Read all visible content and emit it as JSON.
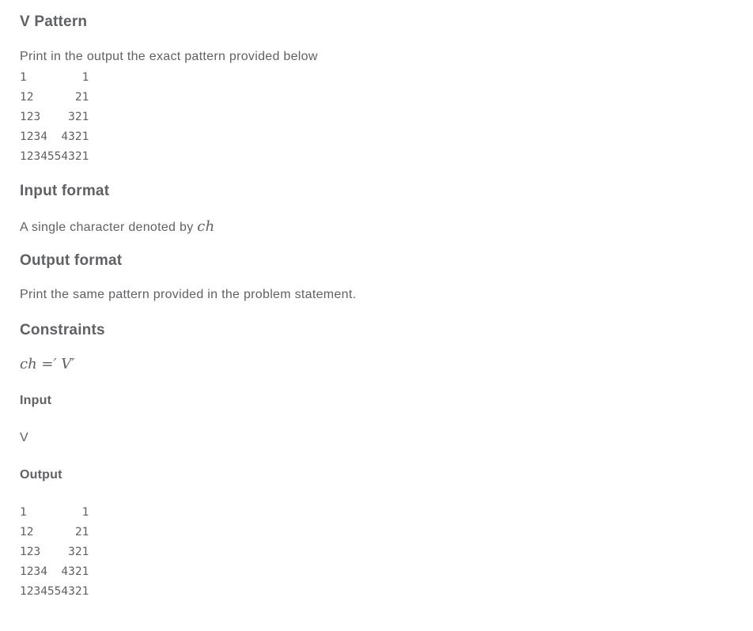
{
  "problem": {
    "title": "V Pattern",
    "statement": "Print in the output the exact pattern provided below",
    "pattern": "1        1\n12      21\n123    321\n1234  4321\n1234554321"
  },
  "input_format": {
    "heading": "Input format",
    "text": "A single character denoted by ",
    "math": "ch"
  },
  "output_format": {
    "heading": "Output format",
    "text": "Print the same pattern provided in the problem statement."
  },
  "constraints": {
    "heading": "Constraints",
    "math": "ch =′ V′"
  },
  "sample": {
    "input_label": "Input",
    "input_value": "V",
    "output_label": "Output",
    "output_value": "1        1\n12      21\n123    321\n1234  4321\n1234554321"
  }
}
